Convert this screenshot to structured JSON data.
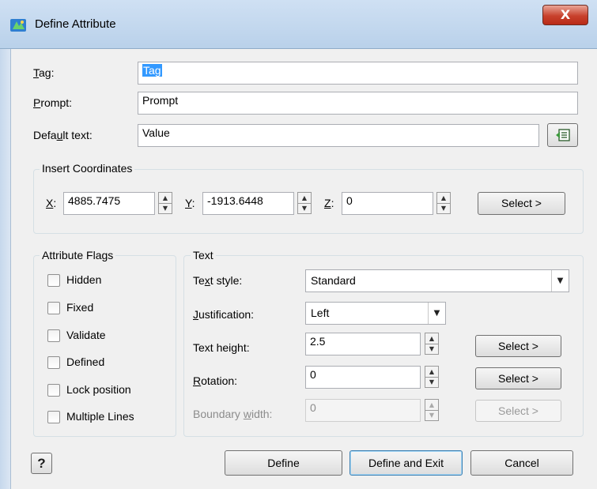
{
  "window": {
    "title": "Define Attribute",
    "close_glyph": "X"
  },
  "fields": {
    "tag": {
      "label": "Tag:",
      "value": "Tag"
    },
    "prompt": {
      "label": "Prompt:",
      "value": "Prompt"
    },
    "default_text": {
      "label": "Default text:",
      "value": "Value",
      "field_button_icon": "insert-field-icon"
    }
  },
  "insert_coordinates": {
    "title": "Insert Coordinates",
    "x": {
      "label": "X:",
      "value": "4885.7475"
    },
    "y": {
      "label": "Y:",
      "value": "-1913.6448"
    },
    "z": {
      "label": "Z:",
      "value": "0"
    },
    "select_label": "Select >"
  },
  "attribute_flags": {
    "title": "Attribute Flags",
    "items": [
      {
        "label": "Hidden",
        "checked": false
      },
      {
        "label": "Fixed",
        "checked": false
      },
      {
        "label": "Validate",
        "checked": false
      },
      {
        "label": "Defined",
        "checked": false
      },
      {
        "label": "Lock position",
        "checked": false
      },
      {
        "label": "Multiple Lines",
        "checked": false
      }
    ]
  },
  "text": {
    "title": "Text",
    "text_style": {
      "label": "Text style:",
      "value": "Standard"
    },
    "justification": {
      "label": "Justification:",
      "value": "Left"
    },
    "text_height": {
      "label": "Text height:",
      "value": "2.5",
      "select_label": "Select >"
    },
    "rotation": {
      "label": "Rotation:",
      "value": "0",
      "select_label": "Select >"
    },
    "boundary_width": {
      "label": "Boundary width:",
      "value": "0",
      "select_label": "Select >",
      "enabled": false
    }
  },
  "buttons": {
    "help": "?",
    "define": "Define",
    "define_and_exit": "Define and Exit",
    "cancel": "Cancel"
  },
  "colors": {
    "title_bar": "#c4d8ee",
    "close_button": "#c8412d",
    "selection": "#3399ff",
    "dialog_bg": "#f0f0f0"
  }
}
